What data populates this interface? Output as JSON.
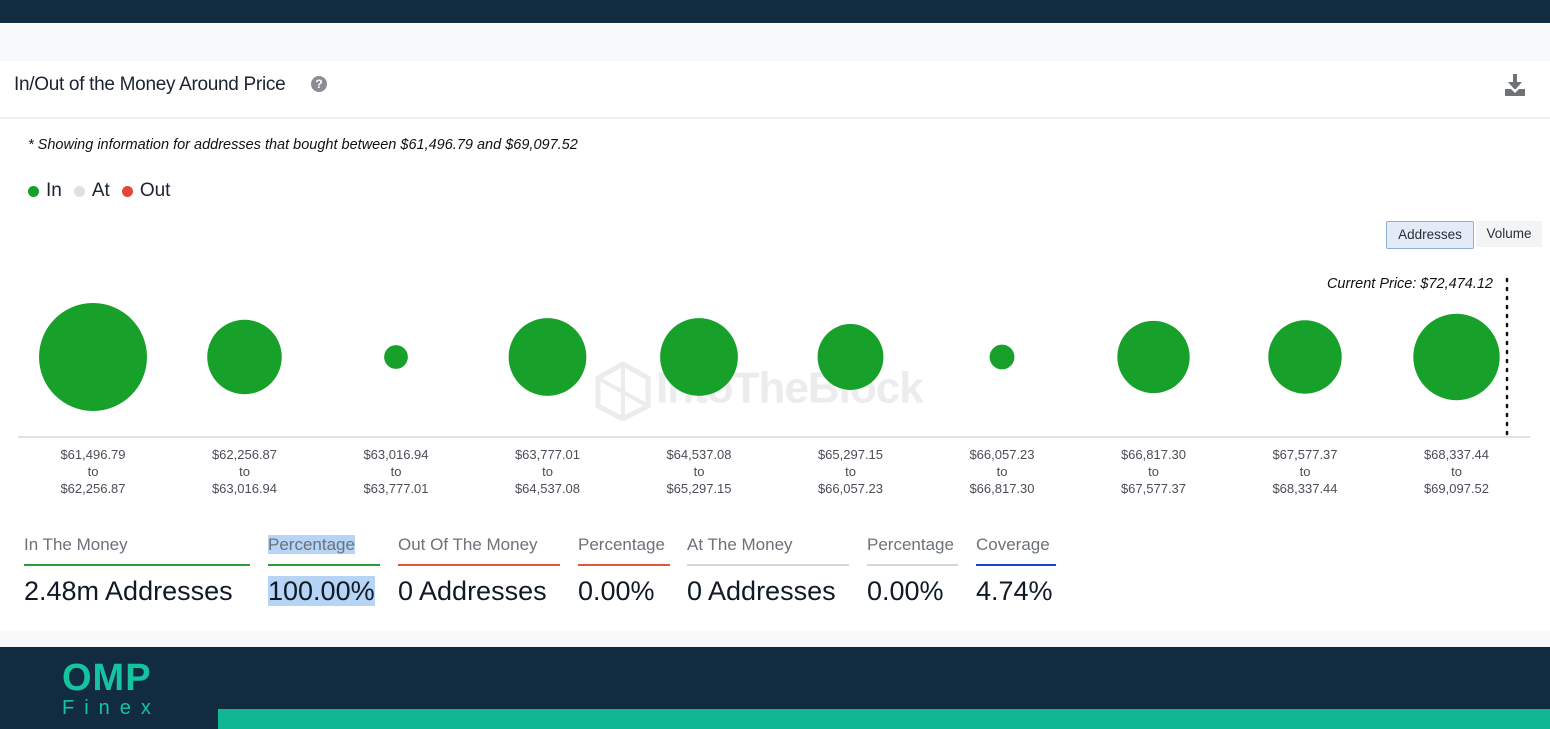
{
  "header": {
    "title": "In/Out of the Money Around Price",
    "help_icon": "question-circle-icon",
    "download_icon": "download-icon"
  },
  "note": "* Showing information for addresses that bought between $61,496.79 and $69,097.52",
  "legend": [
    {
      "label": "In",
      "color": "#17a02a"
    },
    {
      "label": "At",
      "color": "#e0e0e0"
    },
    {
      "label": "Out",
      "color": "#e0493a"
    }
  ],
  "toggle": {
    "addresses_label": "Addresses",
    "volume_label": "Volume",
    "selected": "Addresses"
  },
  "current_price_label": "Current Price: $72,474.12",
  "watermark": "IntoTheBlock",
  "chart_data": {
    "type": "bubble",
    "title": "In/Out of the Money Around Price",
    "size_metric": "Addresses",
    "categories": [
      {
        "from": "$61,496.79",
        "to": "$62,256.87"
      },
      {
        "from": "$62,256.87",
        "to": "$63,016.94"
      },
      {
        "from": "$63,016.94",
        "to": "$63,777.01"
      },
      {
        "from": "$63,777.01",
        "to": "$64,537.08"
      },
      {
        "from": "$64,537.08",
        "to": "$65,297.15"
      },
      {
        "from": "$65,297.15",
        "to": "$66,057.23"
      },
      {
        "from": "$66,057.23",
        "to": "$66,817.30"
      },
      {
        "from": "$66,817.30",
        "to": "$67,577.37"
      },
      {
        "from": "$67,577.37",
        "to": "$68,337.44"
      },
      {
        "from": "$68,337.44",
        "to": "$69,097.52"
      }
    ],
    "relative_size": [
      1.0,
      0.69,
      0.22,
      0.72,
      0.72,
      0.61,
      0.23,
      0.67,
      0.68,
      0.8
    ],
    "status": [
      "In",
      "In",
      "In",
      "In",
      "In",
      "In",
      "In",
      "In",
      "In",
      "In"
    ],
    "range_separator": "to",
    "current_price": "$72,474.12"
  },
  "stats": [
    {
      "label": "In The Money",
      "value": "2.48m Addresses",
      "color": "#2e9b3a"
    },
    {
      "label": "Percentage",
      "value": "100.00%",
      "color": "#2e9b3a",
      "selected": true
    },
    {
      "label": "Out Of The Money",
      "value": "0 Addresses",
      "color": "#e0563f"
    },
    {
      "label": "Percentage",
      "value": "0.00%",
      "color": "#e0563f"
    },
    {
      "label": "At The Money",
      "value": "0 Addresses",
      "color": "#d6d7d9"
    },
    {
      "label": "Percentage",
      "value": "0.00%",
      "color": "#d6d7d9"
    },
    {
      "label": "Coverage",
      "value": "4.74%",
      "color": "#1f44d4"
    }
  ],
  "footer": {
    "logo_top": "OMP",
    "logo_bottom": "Finex"
  }
}
